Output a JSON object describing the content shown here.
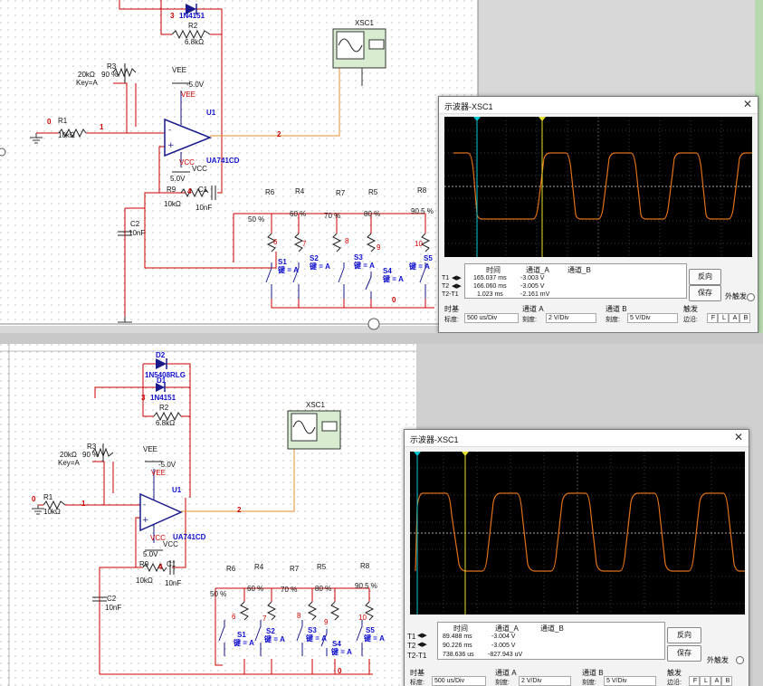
{
  "top": {
    "parts": {
      "d_num": "3",
      "d_name": "1N4151",
      "r2_name": "R2",
      "r2_val": "6.8kΩ",
      "r3_name": "R3",
      "r3_val": "20kΩ",
      "r3_pct": "90 %",
      "r3_key": "Key=A",
      "vee": "VEE",
      "vee_val": "-5.0V",
      "vee_red": "VEE",
      "vcc_red": "VCC",
      "vcc": "VCC",
      "vcc_val": "5.0V",
      "u1": "U1",
      "u1_model": "UA741CD",
      "n0": "0",
      "r1_name": "R1",
      "r1_val": "10kΩ",
      "n1": "1",
      "n2": "2",
      "xsc": "XSC1",
      "r9_name": "R9",
      "r9_val": "10kΩ",
      "n4": "4",
      "c1_name": "C1",
      "c1_val": "10nF",
      "c2_name": "C2",
      "c2_val": "10nF",
      "r_names": [
        "R6",
        "R4",
        "R7",
        "R5",
        "R8"
      ],
      "r_pcts": [
        "50 %",
        "60 %",
        "70 %",
        "80 %",
        "90.5 %"
      ],
      "r_nodes": [
        "6",
        "7",
        "8",
        "9",
        "10"
      ],
      "s_names": [
        "S1",
        "S2",
        "S3",
        "S4",
        "S5"
      ],
      "s_key": "键 = A",
      "n0b": "0"
    },
    "scope": {
      "title": "示波器-XSC1",
      "col_time": "时间",
      "col_a": "通道_A",
      "col_b": "通道_B",
      "rows": [
        {
          "label": "T1",
          "time": "165.037 ms",
          "a": "-3.003 V",
          "b": ""
        },
        {
          "label": "T2",
          "time": "166.060 ms",
          "a": "-3.005 V",
          "b": ""
        },
        {
          "label": "T2-T1",
          "time": "1.023 ms",
          "a": "-2.161 mV",
          "b": ""
        }
      ],
      "btn_reverse": "反向",
      "btn_save": "保存",
      "ext_trigger": "外触发",
      "timebase_label": "时基",
      "scale_label": "标度:",
      "timebase_val": "500 us/Div",
      "cha_label": "通道 A",
      "cha_scale_label": "刻度:",
      "cha_val": "2 V/Div",
      "chb_label": "通道 B",
      "chb_scale_label": "刻度:",
      "chb_val": "5 V/Div",
      "trig_label": "触发",
      "edge_label": "边沿:",
      "trig_btns": [
        "F",
        "L",
        "A",
        "B"
      ]
    }
  },
  "bottom": {
    "parts": {
      "d2": "D2",
      "d2_model": "1N5408RLG",
      "d1": "D1",
      "d_num": "3",
      "d_name": "1N4151",
      "r2_name": "R2",
      "r2_val": "6.8kΩ",
      "r3_name": "R3",
      "r3_val": "20kΩ",
      "r3_pct": "90 %",
      "r3_key": "Key=A",
      "vee": "VEE",
      "vee_val": "-5.0V",
      "vee_red": "VEE",
      "vcc_red": "VCC",
      "vcc": "VCC",
      "vcc_val": "5.0V",
      "u1": "U1",
      "u1_model": "UA741CD",
      "n0": "0",
      "r1_name": "R1",
      "r1_val": "10kΩ",
      "n1": "1",
      "n2": "2",
      "xsc": "XSC1",
      "r9_name": "R9",
      "r9_val": "10kΩ",
      "n4": "4",
      "c1_name": "C1",
      "c1_val": "10nF",
      "c2_name": "C2",
      "c2_val": "10nF",
      "r_names": [
        "R6",
        "R4",
        "R7",
        "R5",
        "R8"
      ],
      "r_pcts": [
        "50 %",
        "60 %",
        "70 %",
        "80 %",
        "90.5 %"
      ],
      "r_nodes": [
        "6",
        "7",
        "8",
        "9",
        "10"
      ],
      "s_names": [
        "S1",
        "S2",
        "S3",
        "S4",
        "S5"
      ],
      "s_key": "键 = A",
      "n0b": "0"
    },
    "scope": {
      "title": "示波器-XSC1",
      "col_time": "时间",
      "col_a": "通道_A",
      "col_b": "通道_B",
      "rows": [
        {
          "label": "T1",
          "time": "89.488 ms",
          "a": "-3.004 V",
          "b": ""
        },
        {
          "label": "T2",
          "time": "90.226 ms",
          "a": "-3.005 V",
          "b": ""
        },
        {
          "label": "T2-T1",
          "time": "738.636 us",
          "a": "-827.943 uV",
          "b": ""
        }
      ],
      "btn_reverse": "反向",
      "btn_save": "保存",
      "ext_trigger": "外触发",
      "timebase_label": "时基",
      "scale_label": "标度:",
      "timebase_val": "500 us/Div",
      "cha_label": "通道 A",
      "cha_scale_label": "刻度:",
      "cha_val": "2 V/Div",
      "chb_label": "通道 B",
      "chb_scale_label": "刻度:",
      "chb_val": "5 V/Div",
      "trig_label": "触发",
      "edge_label": "边沿:",
      "trig_btns": [
        "F",
        "L",
        "A",
        "B"
      ]
    }
  },
  "colors": {
    "wire": "#cc0000",
    "component": "#0000cc",
    "probe_wire": "#e09030",
    "trace": "#e07018",
    "cursor1": "#00c8d0",
    "cursor2": "#e8e030"
  }
}
